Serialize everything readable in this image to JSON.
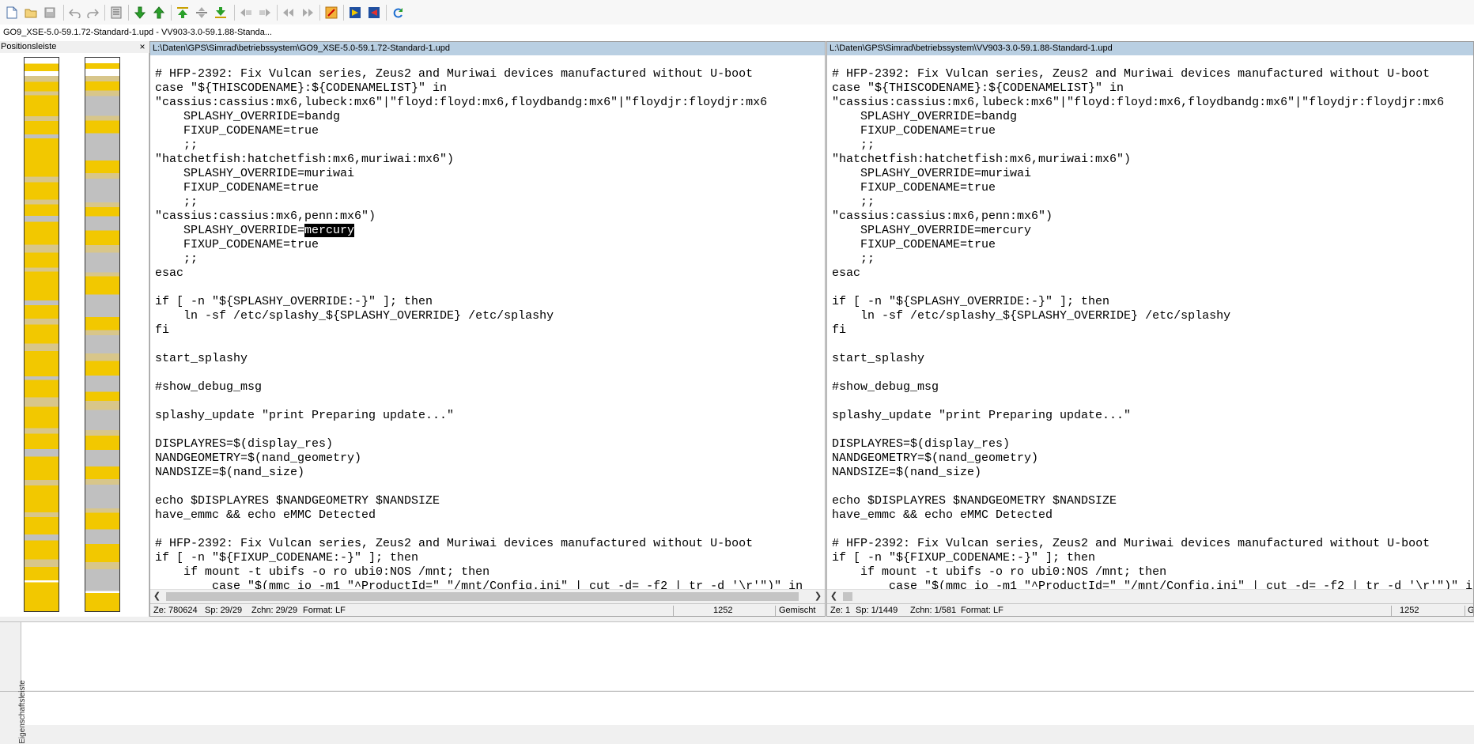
{
  "tab": {
    "label": "GO9_XSE-5.0-59.1.72-Standard-1.upd - VV903-3.0-59.1.88-Standa..."
  },
  "toolbar": {
    "icons": [
      "new-file-icon",
      "open-folder-icon",
      "save-icon",
      "undo-icon",
      "redo-icon",
      "options-icon",
      "next-diff-icon",
      "prev-diff-icon",
      "first-diff-icon",
      "current-diff-icon",
      "last-diff-icon",
      "copy-left-icon",
      "copy-right-icon",
      "copy-all-left-icon",
      "copy-all-right-icon",
      "edit-icon",
      "merge-icon",
      "merge-alt-icon",
      "refresh-icon"
    ]
  },
  "position_bar": {
    "title": "Positionsleiste",
    "close": "×",
    "colors": {
      "changed": "#f2c800",
      "trivial": "#d8c68a",
      "missing": "#c0c0c0",
      "blank": "#ffffff"
    }
  },
  "left_pane": {
    "path": "L:\\Daten\\GPS\\Simrad\\betriebssystem\\GO9_XSE-5.0-59.1.72-Standard-1.upd",
    "status": {
      "line": "Ze: 780624",
      "col": "Sp: 29/29",
      "chars": "Zchn: 29/29",
      "format": "Format: LF",
      "codepage": "1252",
      "mode": "Gemischt"
    }
  },
  "right_pane": {
    "path": "L:\\Daten\\GPS\\Simrad\\betriebssystem\\VV903-3.0-59.1.88-Standard-1.upd",
    "status": {
      "line": "Ze: 1",
      "col": "Sp: 1/1449",
      "chars": "Zchn: 1/581",
      "format": "Format: LF",
      "codepage": "1252",
      "mode": "Ge"
    }
  },
  "code": {
    "before_sel": "# HFP-2392: Fix Vulcan series, Zeus2 and Muriwai devices manufactured without U-boot\ncase \"${THISCODENAME}:${CODENAMELIST}\" in\n\"cassius:cassius:mx6,lubeck:mx6\"|\"floyd:floyd:mx6,floydbandg:mx6\"|\"floydjr:floydjr:mx6\n    SPLASHY_OVERRIDE=bandg\n    FIXUP_CODENAME=true\n    ;;\n\"hatchetfish:hatchetfish:mx6,muriwai:mx6\")\n    SPLASHY_OVERRIDE=muriwai\n    FIXUP_CODENAME=true\n    ;;\n\"cassius:cassius:mx6,penn:mx6\")\n    SPLASHY_OVERRIDE=",
    "selection": "mercury",
    "after_sel": "\n    FIXUP_CODENAME=true\n    ;;\nesac\n\nif [ -n \"${SPLASHY_OVERRIDE:-}\" ]; then\n    ln -sf /etc/splashy_${SPLASHY_OVERRIDE} /etc/splashy\nfi\n\nstart_splashy\n\n#show_debug_msg\n\nsplashy_update \"print Preparing update...\"\n\nDISPLAYRES=$(display_res)\nNANDGEOMETRY=$(nand_geometry)\nNANDSIZE=$(nand_size)\n\necho $DISPLAYRES $NANDGEOMETRY $NANDSIZE\nhave_emmc && echo eMMC Detected\n\n# HFP-2392: Fix Vulcan series, Zeus2 and Muriwai devices manufactured without U-boot\nif [ -n \"${FIXUP_CODENAME:-}\" ]; then\n    if mount -t ubifs -o ro ubi0:NOS /mnt; then\n        case \"$(mmc_io -m1 \"^ProductId=\" \"/mnt/Config.ini\" | cut -d= -f2 | tr -d '\\r'\")\" in"
  },
  "bottom": {
    "side_label": "Eigenschaftsleiste"
  }
}
